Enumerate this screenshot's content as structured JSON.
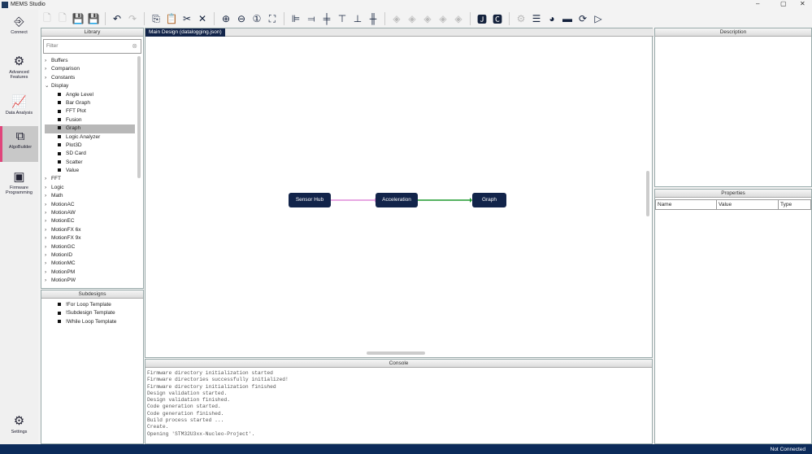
{
  "window": {
    "title": "MEMS Studio",
    "minimize": "–",
    "maximize": "▢",
    "close": "✕"
  },
  "toolbar": {
    "icons": [
      "new-file-icon",
      "new-design-icon",
      "save-icon",
      "save-as-icon",
      "undo-icon",
      "redo-icon",
      "copy-icon",
      "paste-icon",
      "cut-icon",
      "delete-icon",
      "zoom-in-icon",
      "zoom-out-icon",
      "zoom-reset-icon",
      "fit-screen-icon",
      "align-left-icon",
      "align-right-icon",
      "align-center-icon",
      "align-top-icon",
      "align-bottom-icon",
      "align-middle-icon",
      "layer-1-icon",
      "layer-2-icon",
      "layer-3-icon",
      "layer-4-icon",
      "layer-5-icon",
      "json-file-icon",
      "c-file-icon",
      "chip-settings-icon",
      "generate-icon",
      "validate-icon",
      "flash-icon",
      "refresh-icon",
      "run-icon"
    ]
  },
  "nav": {
    "items": [
      {
        "label": "Connect"
      },
      {
        "label": "Advanced Features"
      },
      {
        "label": "Data Analysis"
      },
      {
        "label": "AlgoBuilder"
      },
      {
        "label": "Firmware Programming"
      }
    ],
    "settings": "Settings"
  },
  "library": {
    "title": "Library",
    "filter_placeholder": "Filter",
    "items": [
      {
        "label": "Buffers",
        "type": "folder"
      },
      {
        "label": "Comparison",
        "type": "folder"
      },
      {
        "label": "Constants",
        "type": "folder"
      },
      {
        "label": "Display",
        "type": "open"
      },
      {
        "label": "Angle Level",
        "type": "child"
      },
      {
        "label": "Bar Graph",
        "type": "child"
      },
      {
        "label": "FFT Plot",
        "type": "child"
      },
      {
        "label": "Fusion",
        "type": "child"
      },
      {
        "label": "Graph",
        "type": "child",
        "selected": true
      },
      {
        "label": "Logic Analyzer",
        "type": "child"
      },
      {
        "label": "Plot3D",
        "type": "child"
      },
      {
        "label": "SD Card",
        "type": "child"
      },
      {
        "label": "Scatter",
        "type": "child"
      },
      {
        "label": "Value",
        "type": "child"
      },
      {
        "label": "FFT",
        "type": "folder"
      },
      {
        "label": "Logic",
        "type": "folder"
      },
      {
        "label": "Math",
        "type": "folder"
      },
      {
        "label": "MotionAC",
        "type": "folder"
      },
      {
        "label": "MotionAW",
        "type": "folder"
      },
      {
        "label": "MotionEC",
        "type": "folder"
      },
      {
        "label": "MotionFX 6x",
        "type": "folder"
      },
      {
        "label": "MotionFX 9x",
        "type": "folder"
      },
      {
        "label": "MotionGC",
        "type": "folder"
      },
      {
        "label": "MotionID",
        "type": "folder"
      },
      {
        "label": "MotionMC",
        "type": "folder"
      },
      {
        "label": "MotionPM",
        "type": "folder"
      },
      {
        "label": "MotionPW",
        "type": "folder"
      }
    ]
  },
  "subdesigns": {
    "title": "Subdesigns",
    "items": [
      "!For Loop Template",
      "!Subdesign Template",
      "!While Loop Template"
    ]
  },
  "design": {
    "tab": "Main Design (datalogging.json)",
    "nodes": [
      "Sensor Hub",
      "Acceleration",
      "Graph"
    ],
    "colors": {
      "link1": "#e08ad8",
      "link2": "#1e9a2e",
      "node": "#12244a"
    }
  },
  "console": {
    "title": "Console",
    "lines": [
      "Firmware directory initialization started",
      "Firmware directories successfully initialized!",
      "Firmware directory initialization finished",
      "Design validation started.",
      "Design validation finished.",
      "Code generation started.",
      "Code generation finished.",
      "Build process started ...",
      "Create.",
      "Opening 'STM32U3xx-Nucleo-Project'."
    ]
  },
  "description": {
    "title": "Description"
  },
  "properties": {
    "title": "Properties",
    "columns": [
      "Name",
      "Value",
      "Type"
    ]
  },
  "status": {
    "text": "Not Connected"
  }
}
